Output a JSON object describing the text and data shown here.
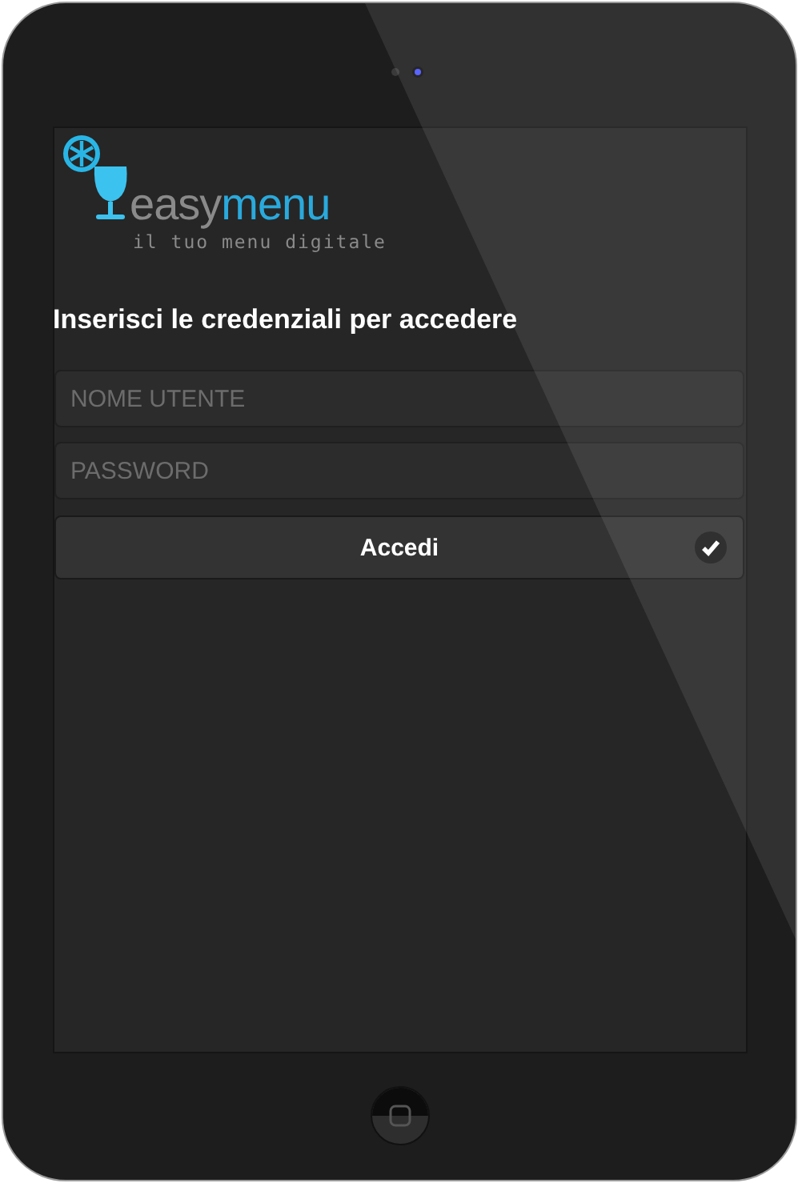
{
  "logo": {
    "name_part_1": "easy",
    "name_part_2": "menu",
    "tagline": "il tuo menu digitale"
  },
  "heading": "Inserisci le credenziali per accedere",
  "fields": [
    {
      "placeholder": "NOME UTENTE"
    },
    {
      "placeholder": "PASSWORD"
    }
  ],
  "submit_button": {
    "label": "Accedi"
  }
}
